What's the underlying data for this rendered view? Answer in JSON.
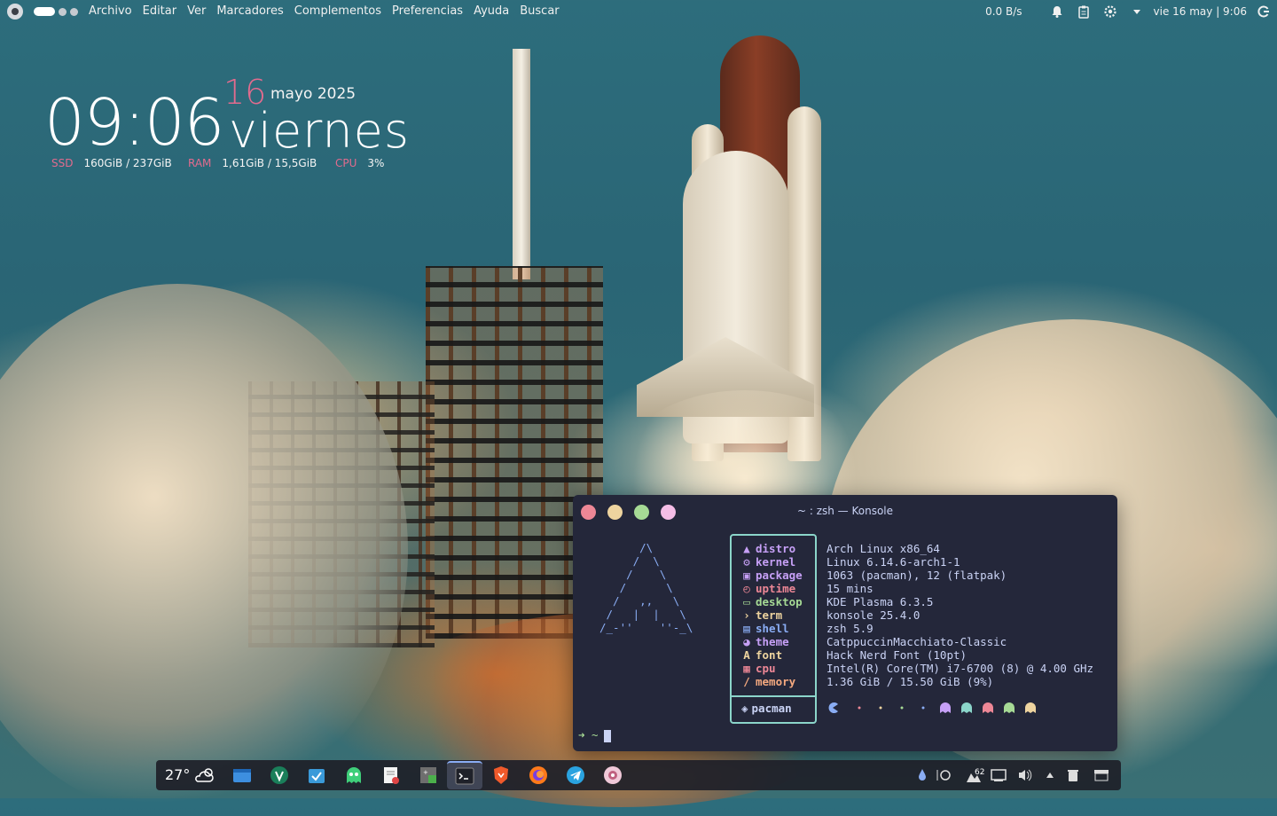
{
  "topbar": {
    "menus": [
      "Archivo",
      "Editar",
      "Ver",
      "Marcadores",
      "Complementos",
      "Preferencias",
      "Ayuda",
      "Buscar"
    ],
    "net_speed": "0.0 B/s",
    "datetime": "vie 16 may | 9:06"
  },
  "widget": {
    "time": "09:06",
    "day_number": "16",
    "month_year": "mayo 2025",
    "weekday": "viernes",
    "ssd_label": "SSD",
    "ssd_value": "160GiB / 237GiB",
    "ram_label": "RAM",
    "ram_value": "1,61GiB / 15,5GiB",
    "cpu_label": "CPU",
    "cpu_value": "3%"
  },
  "konsole": {
    "title": "~ : zsh — Konsole",
    "ascii_art": "      /\\\n     /  \\\n    /    \\\n   /      \\\n  /   ,,   \\\n /   |  |   \\\n/_-''    ''-_\\",
    "labels": [
      {
        "icon": "arch-icon",
        "glyph": "▲",
        "text": "distro",
        "color": "#c6a0f6"
      },
      {
        "icon": "gear-icon",
        "glyph": "⚙",
        "text": "kernel",
        "color": "#c6a0f6"
      },
      {
        "icon": "package-icon",
        "glyph": "▣",
        "text": "package",
        "color": "#c6a0f6"
      },
      {
        "icon": "clock-icon",
        "glyph": "◴",
        "text": "uptime",
        "color": "#ed8796"
      },
      {
        "icon": "monitor-icon",
        "glyph": "▭",
        "text": "desktop",
        "color": "#a6da95"
      },
      {
        "icon": "terminal-icon",
        "glyph": "›",
        "text": "term",
        "color": "#eed49f"
      },
      {
        "icon": "shell-icon",
        "glyph": "▤",
        "text": "shell",
        "color": "#8aadf4"
      },
      {
        "icon": "palette-icon",
        "glyph": "◕",
        "text": "theme",
        "color": "#c6a0f6"
      },
      {
        "icon": "font-icon",
        "glyph": "A",
        "text": "font",
        "color": "#eed49f"
      },
      {
        "icon": "cpu-icon",
        "glyph": "▦",
        "text": "cpu",
        "color": "#ed8796"
      },
      {
        "icon": "memory-icon",
        "glyph": "∕",
        "text": "memory",
        "color": "#f5a97f"
      }
    ],
    "values": [
      "Arch Linux x86_64",
      "Linux 6.14.6-arch1-1",
      "1063 (pacman), 12 (flatpak)",
      "15 mins",
      "KDE Plasma 6.3.5",
      "konsole 25.4.0",
      "zsh 5.9",
      "CatppuccinMacchiato-Classic",
      "Hack Nerd Font (10pt)",
      "Intel(R) Core(TM) i7-6700 (8) @ 4.00 GHz",
      "1.36 GiB / 15.50 GiB (9%)"
    ],
    "pacman_label": "pacman",
    "prompt": "➜  ~"
  },
  "dock": {
    "temperature": "27°",
    "tray_badge": "62"
  },
  "colors": {
    "accent_pink": "#e26b8e",
    "terminal_bg": "#24273a",
    "teal_border": "#8bd5ca",
    "blue": "#8aadf4"
  }
}
